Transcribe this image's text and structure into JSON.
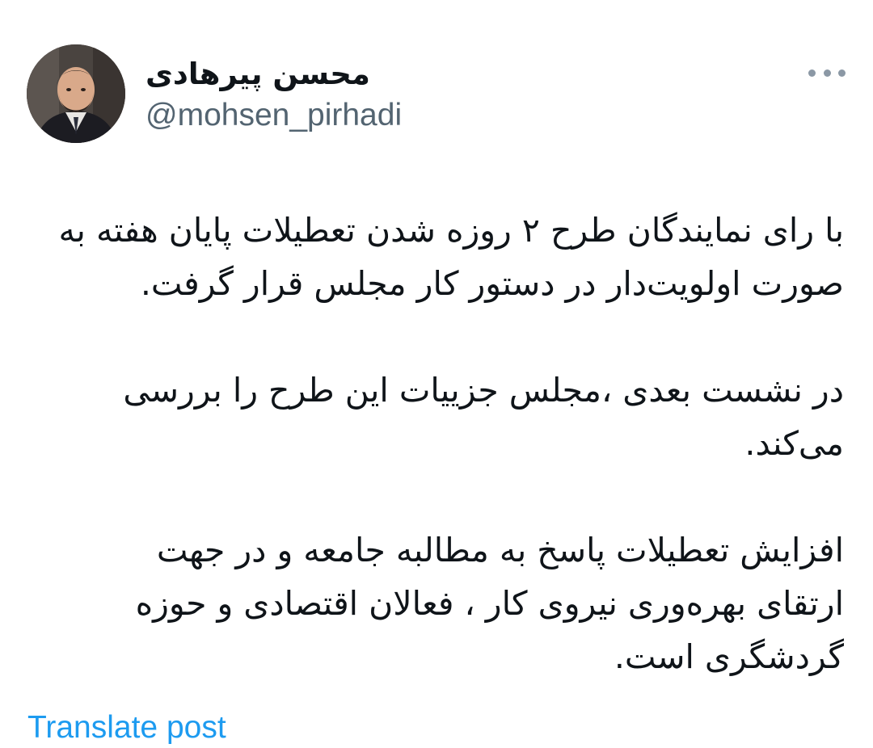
{
  "tweet": {
    "author": {
      "display_name": "محسن پیرهادی",
      "handle": "@mohsen_pirhadi",
      "avatar_icon": "user-photo"
    },
    "more_icon": "more-horizontal-icon",
    "paragraphs": [
      "با رای نمایندگان طرح ۲ روزه شدن تعطیلات پایان هفته به\nصورت اولویت‌دار در دستور  کار مجلس قرار گرفت.",
      "در نشست بعدی ،مجلس جزییات این طرح را بررسی\nمی‌کند.",
      "افزایش تعطیلات پاسخ به مطالبه جامعه و در جهت\nارتقای بهره‌وری نیروی کار ، فعالان اقتصادی و حوزه\nگردشگری است."
    ],
    "translate_label": "Translate post"
  },
  "colors": {
    "text": "#0f1419",
    "secondary": "#536471",
    "link": "#1d9bf0"
  }
}
